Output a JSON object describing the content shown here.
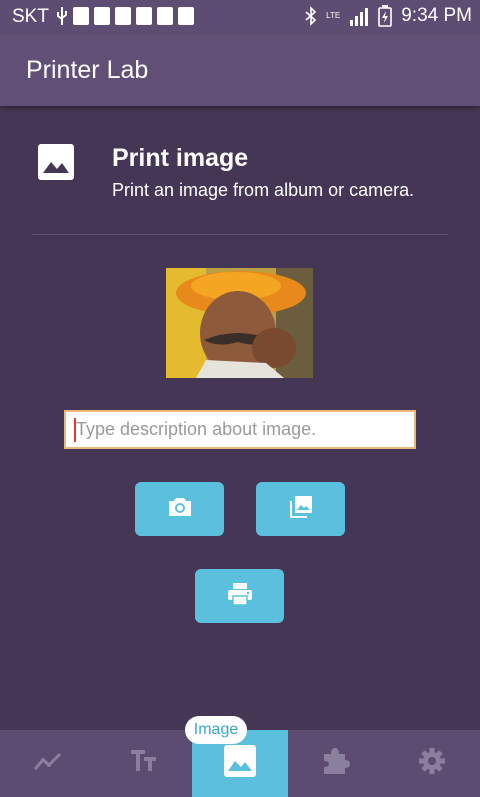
{
  "status_bar": {
    "carrier": "SKT",
    "lte": "LTE",
    "time": "9:34 PM"
  },
  "app_bar": {
    "title": "Printer Lab"
  },
  "header": {
    "title": "Print image",
    "subtitle": "Print an image from album or camera."
  },
  "description_input": {
    "value": "",
    "placeholder": "Type description about image."
  },
  "bottom_nav": {
    "active_tooltip": "Image",
    "items": [
      "chart-line-icon",
      "text-size-icon",
      "image-icon",
      "puzzle-icon",
      "gear-icon"
    ]
  },
  "colors": {
    "background": "#443654",
    "app_bar": "#614f76",
    "accent": "#5bc0de",
    "input_border": "#e9b97a"
  }
}
